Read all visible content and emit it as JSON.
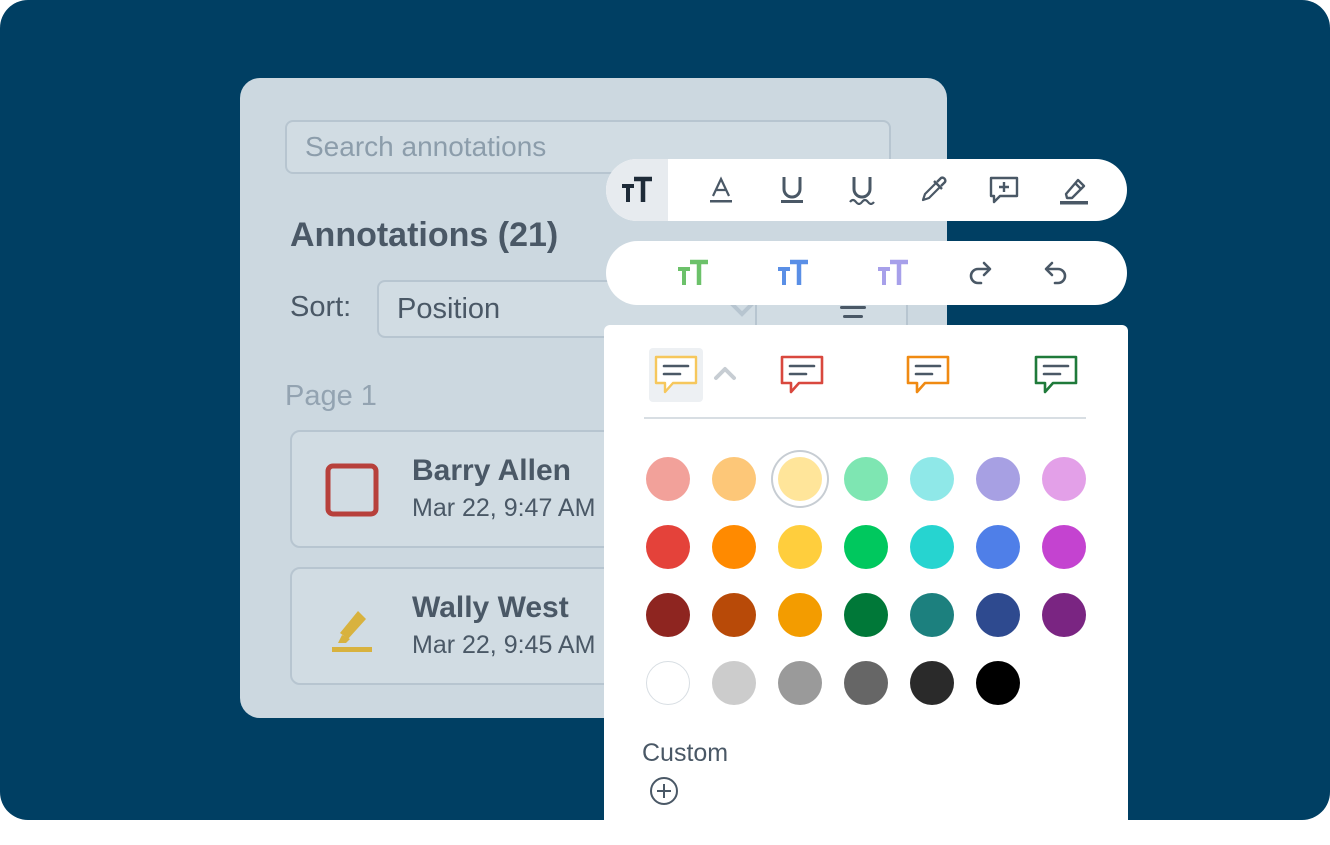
{
  "search": {
    "placeholder": "Search annotations"
  },
  "panel": {
    "title": "Annotations (21)",
    "sort_label": "Sort:",
    "sort_value": "Position",
    "page_label": "Page 1"
  },
  "annotations": [
    {
      "author": "Barry Allen",
      "date": "Mar 22, 9:47 AM",
      "icon": "square-icon",
      "color": "#B7403B"
    },
    {
      "author": "Wally West",
      "date": "Mar 22, 9:45 AM",
      "icon": "highlighter-icon",
      "color": "#D8B23E"
    }
  ],
  "toolbar_primary": [
    {
      "icon": "text-size-icon",
      "active": true
    },
    {
      "icon": "text-color-icon"
    },
    {
      "icon": "underline-icon"
    },
    {
      "icon": "squiggly-underline-icon"
    },
    {
      "icon": "eyedropper-icon"
    },
    {
      "icon": "add-comment-icon"
    },
    {
      "icon": "highlighter-icon"
    }
  ],
  "toolbar_secondary": [
    {
      "icon": "text-size-green-icon",
      "color": "#6CC16A"
    },
    {
      "icon": "text-size-blue-icon",
      "color": "#5A8FE6"
    },
    {
      "icon": "text-size-purple-icon",
      "color": "#A7A0EA"
    },
    {
      "icon": "redo-icon"
    },
    {
      "icon": "undo-icon"
    }
  ],
  "note_styles": [
    {
      "icon": "note-yellow-icon",
      "color": "#F6C75C",
      "selected": true
    },
    {
      "icon": "note-red-icon",
      "color": "#D9483E"
    },
    {
      "icon": "note-orange-icon",
      "color": "#F08A12"
    },
    {
      "icon": "note-green-icon",
      "color": "#1F7A3A"
    }
  ],
  "palette": [
    [
      "#F2A19A",
      "#FDC778",
      "#FFE59A",
      "#7EE6B2",
      "#8FE8E8",
      "#A7A0E3",
      "#E3A0E8"
    ],
    [
      "#E4423A",
      "#FF8A00",
      "#FFCE3D",
      "#00C85E",
      "#26D4D0",
      "#4F7FE8",
      "#C443D0"
    ],
    [
      "#8E2520",
      "#B84A08",
      "#F39C00",
      "#007838",
      "#1C807E",
      "#2E4A8F",
      "#7A2582"
    ],
    [
      "#FFFFFF",
      "#CCCCCC",
      "#9A9A9A",
      "#666666",
      "#2A2A2A",
      "#000000"
    ]
  ],
  "selected_color": "#FFE59A",
  "custom_label": "Custom"
}
